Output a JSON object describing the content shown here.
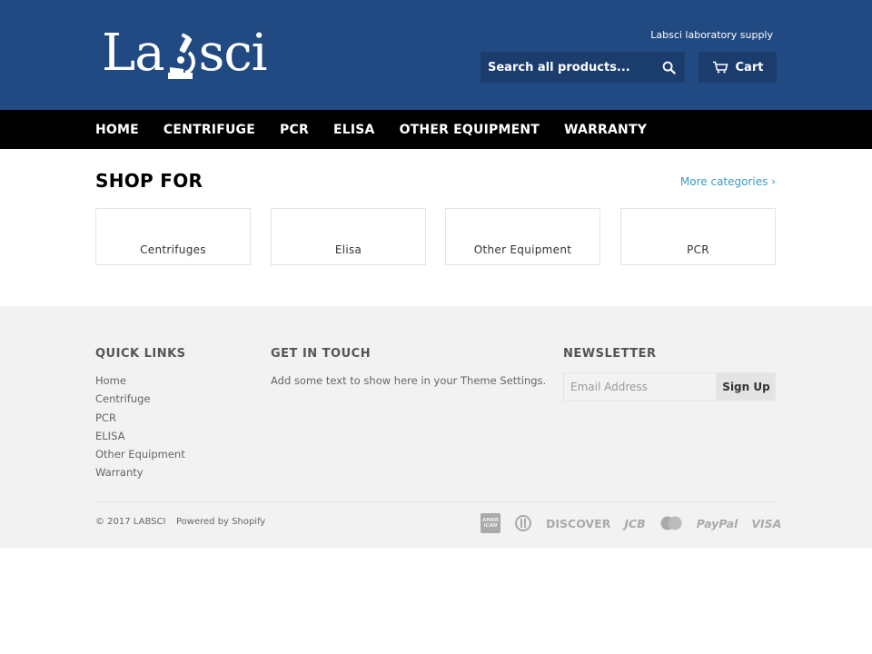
{
  "header": {
    "logo_text": "Labsci",
    "tagline": "Labsci laboratory supply",
    "search": {
      "placeholder": "Search all products...",
      "icon": "search-icon"
    },
    "cart": {
      "label": "Cart",
      "icon": "cart-icon"
    },
    "colors": {
      "background": "#224a82",
      "control": "#1b3d6e"
    }
  },
  "nav": {
    "items": [
      "HOME",
      "CENTRIFUGE",
      "PCR",
      "ELISA",
      "OTHER EQUIPMENT",
      "WARRANTY"
    ],
    "background": "#000000"
  },
  "shop": {
    "title": "SHOP FOR",
    "more_link": "More categories ›",
    "categories": [
      "Centrifuges",
      "Elisa",
      "Other Equipment",
      "PCR"
    ]
  },
  "footer": {
    "quick_links": {
      "title": "QUICK LINKS",
      "items": [
        "Home",
        "Centrifuge",
        "PCR",
        "ELISA",
        "Other Equipment",
        "Warranty"
      ]
    },
    "get_in_touch": {
      "title": "GET IN TOUCH",
      "text": "Add some text to show here in your Theme Settings."
    },
    "newsletter": {
      "title": "NEWSLETTER",
      "placeholder": "Email Address",
      "button": "Sign Up"
    },
    "copyright": "© 2017 LABSCI",
    "powered_by": "Powered by Shopify",
    "payments": [
      "american-express",
      "diners-club",
      "DISCOVER",
      "JCB",
      "mastercard",
      "PayPal",
      "VISA"
    ]
  },
  "colors": {
    "link": "#3a9bc4",
    "footer_bg": "#f2f2f2"
  }
}
